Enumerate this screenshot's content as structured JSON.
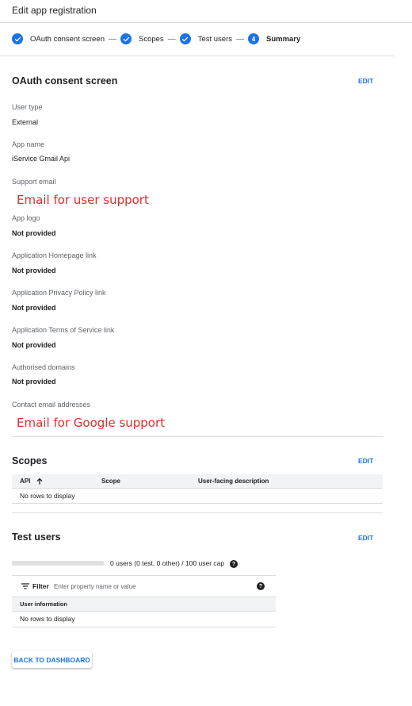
{
  "header": {
    "title": "Edit app registration"
  },
  "stepper": {
    "steps": [
      {
        "label": "OAuth consent screen",
        "status": "done"
      },
      {
        "label": "Scopes",
        "status": "done"
      },
      {
        "label": "Test users",
        "status": "done"
      },
      {
        "label": "Summary",
        "status": "current",
        "number": "4"
      }
    ],
    "separator": "—"
  },
  "oauth": {
    "title": "OAuth consent screen",
    "edit_label": "EDIT",
    "fields": [
      {
        "label": "User type",
        "value": "External"
      },
      {
        "label": "App name",
        "value": "iService Gmail Api"
      },
      {
        "label": "Support email",
        "value": "Email for user support"
      },
      {
        "label": "App logo",
        "value": "Not provided"
      },
      {
        "label": "Application Homepage link",
        "value": "Not provided"
      },
      {
        "label": "Application Privacy Policy link",
        "value": "Not provided"
      },
      {
        "label": "Application Terms of Service link",
        "value": "Not provided"
      },
      {
        "label": "Authorised domains",
        "value": "Not provided"
      },
      {
        "label": "Contact email addresses",
        "value": "Email for Google support"
      }
    ]
  },
  "scopes": {
    "title": "Scopes",
    "edit_label": "EDIT",
    "columns": [
      "API",
      "Scope",
      "User-facing description"
    ],
    "empty_text": "No rows to display"
  },
  "test_users": {
    "title": "Test users",
    "edit_label": "EDIT",
    "cap_text": "0 users (0 test, 0 other) / 100 user cap",
    "cap_fraction": 0,
    "help_glyph": "?",
    "filter_label": "Filter",
    "filter_placeholder": "Enter property name or value",
    "column": "User information",
    "empty_text": "No rows to display"
  },
  "footer": {
    "back_label": "BACK TO DASHBOARD"
  },
  "colors": {
    "accent": "#1a73e8",
    "annotation": "#e32b2b",
    "divider": "#dadce0"
  }
}
